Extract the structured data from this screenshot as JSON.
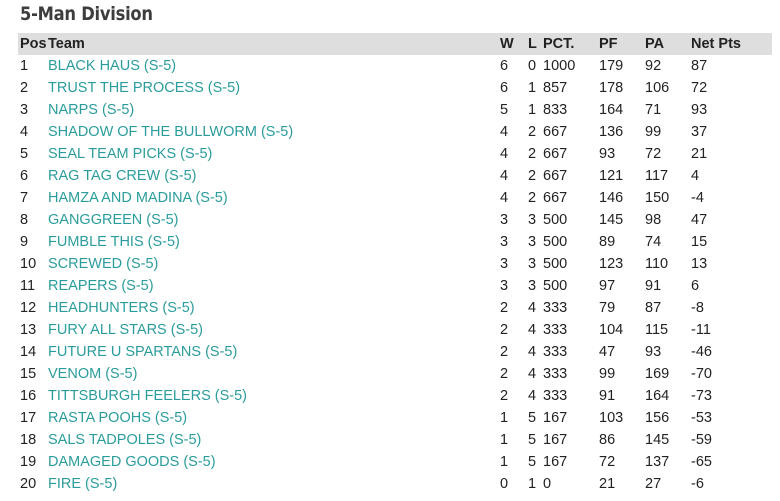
{
  "title": "5-Man Division",
  "headers": {
    "pos": "Pos",
    "team": "Team",
    "w": "W",
    "l": "L",
    "pct": "PCT.",
    "pf": "PF",
    "pa": "PA",
    "net": "Net Pts"
  },
  "rows": [
    {
      "pos": "1",
      "team": "BLACK HAUS (S-5)",
      "w": "6",
      "l": "0",
      "pct": "1000",
      "pf": "179",
      "pa": "92",
      "net": "87"
    },
    {
      "pos": "2",
      "team": "TRUST THE PROCESS (S-5)",
      "w": "6",
      "l": "1",
      "pct": "857",
      "pf": "178",
      "pa": "106",
      "net": "72"
    },
    {
      "pos": "3",
      "team": "NARPS (S-5)",
      "w": "5",
      "l": "1",
      "pct": "833",
      "pf": "164",
      "pa": "71",
      "net": "93"
    },
    {
      "pos": "4",
      "team": "SHADOW OF THE BULLWORM (S-5)",
      "w": "4",
      "l": "2",
      "pct": "667",
      "pf": "136",
      "pa": "99",
      "net": "37"
    },
    {
      "pos": "5",
      "team": "SEAL TEAM PICKS (S-5)",
      "w": "4",
      "l": "2",
      "pct": "667",
      "pf": "93",
      "pa": "72",
      "net": "21"
    },
    {
      "pos": "6",
      "team": "RAG TAG CREW (S-5)",
      "w": "4",
      "l": "2",
      "pct": "667",
      "pf": "121",
      "pa": "117",
      "net": "4"
    },
    {
      "pos": "7",
      "team": "HAMZA AND MADINA (S-5)",
      "w": "4",
      "l": "2",
      "pct": "667",
      "pf": "146",
      "pa": "150",
      "net": "-4"
    },
    {
      "pos": "8",
      "team": "GANGGREEN (S-5)",
      "w": "3",
      "l": "3",
      "pct": "500",
      "pf": "145",
      "pa": "98",
      "net": "47"
    },
    {
      "pos": "9",
      "team": "FUMBLE THIS (S-5)",
      "w": "3",
      "l": "3",
      "pct": "500",
      "pf": "89",
      "pa": "74",
      "net": "15"
    },
    {
      "pos": "10",
      "team": "SCREWED (S-5)",
      "w": "3",
      "l": "3",
      "pct": "500",
      "pf": "123",
      "pa": "110",
      "net": "13"
    },
    {
      "pos": "11",
      "team": "REAPERS (S-5)",
      "w": "3",
      "l": "3",
      "pct": "500",
      "pf": "97",
      "pa": "91",
      "net": "6"
    },
    {
      "pos": "12",
      "team": "HEADHUNTERS (S-5)",
      "w": "2",
      "l": "4",
      "pct": "333",
      "pf": "79",
      "pa": "87",
      "net": "-8"
    },
    {
      "pos": "13",
      "team": "FURY ALL STARS (S-5)",
      "w": "2",
      "l": "4",
      "pct": "333",
      "pf": "104",
      "pa": "115",
      "net": "-11"
    },
    {
      "pos": "14",
      "team": "FUTURE U SPARTANS (S-5)",
      "w": "2",
      "l": "4",
      "pct": "333",
      "pf": "47",
      "pa": "93",
      "net": "-46"
    },
    {
      "pos": "15",
      "team": "VENOM (S-5)",
      "w": "2",
      "l": "4",
      "pct": "333",
      "pf": "99",
      "pa": "169",
      "net": "-70"
    },
    {
      "pos": "16",
      "team": "TITTSBURGH FEELERS (S-5)",
      "w": "2",
      "l": "4",
      "pct": "333",
      "pf": "91",
      "pa": "164",
      "net": "-73"
    },
    {
      "pos": "17",
      "team": "RASTA POOHS (S-5)",
      "w": "1",
      "l": "5",
      "pct": "167",
      "pf": "103",
      "pa": "156",
      "net": "-53"
    },
    {
      "pos": "18",
      "team": "SALS TADPOLES (S-5)",
      "w": "1",
      "l": "5",
      "pct": "167",
      "pf": "86",
      "pa": "145",
      "net": "-59"
    },
    {
      "pos": "19",
      "team": "DAMAGED GOODS (S-5)",
      "w": "1",
      "l": "5",
      "pct": "167",
      "pf": "72",
      "pa": "137",
      "net": "-65"
    },
    {
      "pos": "20",
      "team": "FIRE (S-5)",
      "w": "0",
      "l": "1",
      "pct": "0",
      "pf": "21",
      "pa": "27",
      "net": "-6"
    }
  ],
  "colors": {
    "link": "#2b9c9c",
    "header_bg": "#dedede",
    "text": "#222222"
  }
}
